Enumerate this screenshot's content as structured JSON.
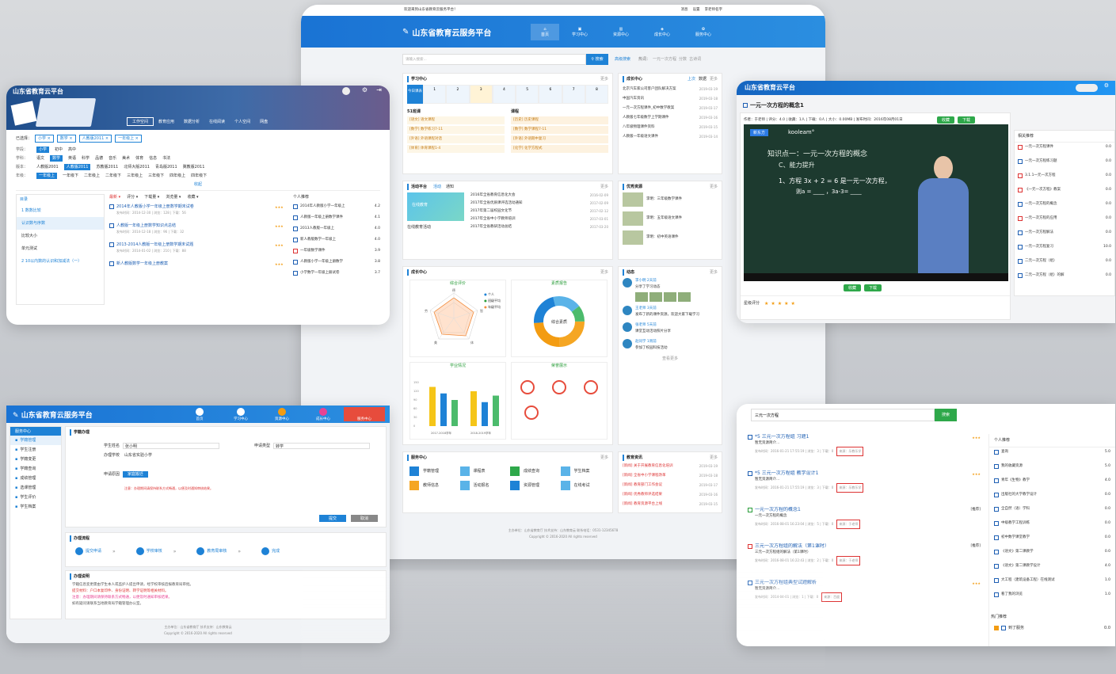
{
  "colors": {
    "brand": "#1e82d6",
    "green": "#2ea84a",
    "red": "#d33"
  },
  "main": {
    "welcome": "欢迎来到山东省教育云服务平台！",
    "top_right": [
      "消息",
      "设置",
      "李老师名字"
    ],
    "logo": "山东省教育云服务平台",
    "nav": [
      "首页",
      "学习中心",
      "资源中心",
      "成长中心",
      "服务中心"
    ],
    "search_placeholder": "请输入搜索...",
    "search_btn": "搜索",
    "adv_search": "高级搜索",
    "hot": "热词：",
    "hot_words": [
      "一元一次方程",
      "分数",
      "古诗词"
    ],
    "study": {
      "title": "学习中心",
      "more": "更多",
      "days": [
        "1",
        "2",
        "3",
        "4",
        "5",
        "6",
        "7",
        "8"
      ],
      "today": "今日课表",
      "left_head": "51班课",
      "right_head": "课程",
      "left": [
        "[语文] 语文课程",
        "[数学] 数学练习7-11",
        "[外语] 外语课程对话",
        "[体育] 体育课程1-4"
      ],
      "right": [
        "[历史] 历史课程",
        "[数学] 数学课程7-11",
        "[外语] 外语期中复习",
        "[化学] 化学方程式"
      ]
    },
    "growth": {
      "title": "成长中心",
      "more": "更多",
      "tabs": [
        "上次",
        "数据",
        "详情"
      ],
      "items": [
        "北京汽车家公司客户团队解决方案",
        "中国汽车资讯",
        "一元一次方程课件_初中数学教案",
        "人教版七年级数学上学期课件",
        "八年级物理课件资料",
        "人教版一年级语文课件"
      ],
      "dates": [
        "2019-03-19",
        "2019-03-18",
        "2019-03-17",
        "2019-03-16",
        "2019-03-15",
        "2019-03-14"
      ]
    },
    "activity": {
      "title": "活动平台",
      "tabs": [
        "活动",
        "通知"
      ],
      "more": "更多",
      "banner": "在线教育",
      "card_title": "在线教育活动",
      "items": [
        "2016年全省教育信息化大会",
        "2017年全省优质课评选活动通知",
        "2017年第二届校园文化节",
        "2017年全省中小学教师培训",
        "2017年全省教研活动总结"
      ],
      "dates": [
        "2016-02-09",
        "2017-02-09",
        "2017-02-12",
        "2017-03-01",
        "2017-03-20"
      ]
    },
    "excellent": {
      "title": "优秀资源",
      "more": "更多",
      "items": [
        "李明：三年级数学课件",
        "李明：五年级语文课件",
        "李明：初中英语课件"
      ]
    },
    "growth2": {
      "title": "成长中心",
      "more": "更多",
      "chart1": "综合评价",
      "chart2": "素质报告",
      "chart3": "学业情况",
      "chart4": "荣誉展示",
      "radar_labels": [
        "德",
        "智",
        "体",
        "美",
        "劳"
      ],
      "legend": [
        "个人",
        "班级平均",
        "年级平均"
      ],
      "bar_years": [
        "2017-2018学年",
        "2018-2019学年"
      ],
      "bars": [
        90,
        75,
        60,
        80,
        55,
        70
      ],
      "donut_center": "综合素质",
      "ticks": [
        "0",
        "30",
        "60",
        "90",
        "120",
        "150"
      ]
    },
    "dynamic": {
      "title": "动态",
      "more": "更多",
      "users": [
        "李小明",
        "王老师",
        "张老师",
        "赵同学"
      ],
      "times": [
        "2天前",
        "3天前",
        "5天前",
        "1周前"
      ],
      "texts": [
        "分享了学习动态",
        "发布了新的课件资源，欢迎大家下载学习",
        "课堂互动活动照片分享",
        "参加了校园科技活动"
      ],
      "more_btn": "查看更多"
    },
    "service": {
      "title": "服务中心",
      "more": "更多",
      "items": [
        "学籍管理",
        "课程表",
        "成绩查询",
        "学生档案",
        "教师信息",
        "活动报名",
        "资源管理",
        "在线考试"
      ]
    },
    "notice": {
      "title": "教育资讯",
      "more": "更多",
      "items": [
        "[新闻] 关于开展教育信息化培训",
        "[新闻] 全省中小学课程改革",
        "[新闻] 教育部门工作会议",
        "[新闻] 优秀教师评选结果",
        "[新闻] 教育资源平台上线"
      ],
      "dates": [
        "2019-03-19",
        "2019-03-18",
        "2019-03-17",
        "2019-03-16",
        "2019-03-15"
      ]
    },
    "footer1": "主办单位：山东省教育厅  技术支持：山东教育云  联系电话：0531-12345678",
    "footer2": "Copyright © 2016-2020 All rights reserved"
  },
  "resource": {
    "logo": "山东省教育云平台",
    "tabs": [
      "工作空间",
      "教育应用",
      "数据分析",
      "在线阅读",
      "个人空间",
      "网盘"
    ],
    "selected_label": "已选择：",
    "selected": [
      "小学",
      "数学",
      "人教版2011",
      "一年级上"
    ],
    "filters": [
      {
        "label": "学段：",
        "items": [
          "小学",
          "初中",
          "高中"
        ]
      },
      {
        "label": "学科：",
        "items": [
          "语文",
          "数学",
          "英语",
          "科学",
          "品德",
          "音乐",
          "美术",
          "体育",
          "信息",
          "书法"
        ]
      },
      {
        "label": "版本：",
        "items": [
          "人教版2001",
          "人教版2011",
          "苏教版2011",
          "北师大版2011",
          "青岛版2011",
          "冀教版2011"
        ]
      },
      {
        "label": "年级：",
        "items": [
          "一年级上",
          "一年级下",
          "二年级上",
          "二年级下",
          "三年级上",
          "三年级下",
          "四年级上",
          "四年级下"
        ]
      }
    ],
    "collapse": "收起",
    "toc_title": "目录",
    "toc": [
      "1 数数比较",
      "认识数与序数",
      "比较大小",
      "单元测试",
      "2 10以内数的认识和加减法（一）"
    ],
    "sort": [
      "最新",
      "评分",
      "下载量",
      "浏览量",
      "收藏"
    ],
    "list": [
      {
        "title": "2014年人教版小学一年级上册数学期末试卷",
        "meta": "发布时间：2014-12-30 | 浏览：128 | 下载：56"
      },
      {
        "title": "人教版一年级上册数学知识点总结",
        "meta": "发布时间：2014-12-18 | 浏览：96 | 下载：32"
      },
      {
        "title": "2013-2014人教版一年级上册数学期末试题",
        "meta": "发布时间：2014-01-02 | 浏览：210 | 下载：88"
      },
      {
        "title": "新人教版数学一年级上册教案"
      }
    ],
    "personal_title": "个人推荐",
    "personal": [
      "2014年人教版小学一年级上",
      "人教版一年级上册数学课件",
      "2013人教版一年级上",
      "新人教版数学一年级上",
      "一年级数学课件",
      "人教版小学一年级上册数学",
      "小学数学一年级上册试卷"
    ],
    "personal_scores": [
      "4.2",
      "4.1",
      "4.0",
      "4.0",
      "3.9",
      "3.8",
      "3.7"
    ]
  },
  "video": {
    "logo": "山东省教育云平台",
    "title": "一元一次方程的概念1",
    "meta": "作者：于老师 | 评分：4.0 | 收藏：1人 | 下载：0人 | 大小：0.00MB | 发布时间：2016年08月01日",
    "collect": "收藏",
    "download": "下载",
    "board_brand": "新东方",
    "board_title": "知识点一：一元一次方程的概念",
    "board_sub": "C、能力提升",
    "board_q": "1、方程 3x + 2 = 6 是一元一次方程，",
    "board_q2": "则a = ____ ，3a-3= ____",
    "rating_label": "星级评分",
    "related_title": "相关推荐",
    "related": [
      "一元一次方程课件",
      "一元一次方程练习题",
      "3.1.1一元一次方程",
      "《一元一次方程》教案",
      "一元一次方程的概念",
      "一元一次方程的应用",
      "一元一次方程解法",
      "一元一次方程复习",
      "二元一次方程（组）",
      "二元一次方程（组）的解"
    ],
    "related_scores": [
      "0.0",
      "0.0",
      "0.0",
      "0.0",
      "0.0",
      "0.0",
      "0.0",
      "10.0",
      "0.0",
      "0.0"
    ]
  },
  "service": {
    "logo": "山东省教育云服务平台",
    "nav": [
      "首页",
      "学习中心",
      "资源中心",
      "成长中心",
      "服务中心"
    ],
    "side_title": "服务中心",
    "side": [
      "学籍管理",
      "学生注册",
      "学籍变更",
      "学籍查询",
      "成绩管理",
      "选课管理",
      "学生评价",
      "学生档案"
    ],
    "form_title": "学籍办理",
    "form_labels": [
      "学生姓名",
      "申请类型",
      "办理学校",
      "申请原因"
    ],
    "form_values": [
      "张小明",
      "转学",
      "山东省实验小学",
      "家庭搬迁"
    ],
    "submit": "提交",
    "save": "保存",
    "cancel": "取消",
    "flow_title": "办理流程",
    "flow": [
      "提交申请",
      "学校审核",
      "教育局审核",
      "完成"
    ],
    "note_title": "办理说明",
    "notes": [
      "学籍信息变更需由学生本人或监护人提出申请，经学校审核后报教育局审批。",
      "提交材料：户口本复印件、身份证明、转学证明等相关材料。",
      "注意：办理期间请保持联系方式畅通，以便及时通知审核结果。",
      "如有疑问请联系当地教育局学籍管理办公室。"
    ],
    "footer1": "主办单位：山东省教育厅  技术支持：山东教育云",
    "footer2": "Copyright © 2016-2020 All rights reserved"
  },
  "search": {
    "query": "三元一次方程",
    "btn": "搜索",
    "results": [
      {
        "title": "*5 三元一次方程组 习题1",
        "sub": "暂无资源简介...",
        "meta": "发布时间：2016-01-21 17:55:19 | 浏览：3 | 下载：0",
        "src": "来源：乐教乐学"
      },
      {
        "title": "*5 三元一次方程组 教学设计1",
        "sub": "暂无资源简介...",
        "meta": "发布时间：2016-01-21 17:55:19 | 浏览：3 | 下载：0",
        "src": "来源：乐教乐学"
      },
      {
        "title": "一元一次方程的概念1",
        "sub": "一元一次方程的概念",
        "meta": "发布时间：2016-08-01 16:23:04 | 浏览：5 | 下载：0",
        "src": "来源：于老师"
      },
      {
        "title": "三元一次方程组的解法（第1课时）",
        "sub": "三元一次方程组的解法（第1课时）",
        "meta": "发布时间：2016-08-01 16:22:43 | 浏览：2 | 下载：0",
        "src": "来源：于老师"
      },
      {
        "title": "三元一次方程组典型试题解析",
        "sub": "暂无资源简介...",
        "meta": "发布时间：2014-04-01 | 浏览：1 | 下载：0",
        "src": "来源：百度"
      }
    ],
    "tags": [
      "[推荐]",
      "[推荐]",
      "[推荐]"
    ],
    "personal_title": "个人推荐",
    "personal": [
      "查询",
      "我的收藏资源",
      "青年《生物》教学",
      "出版社的大学教学设计",
      "全自然（语）学科",
      "中级教学工程训练",
      "初中数学课堂教学",
      "《语文》第二课教学",
      "《语文》第二课教学设计",
      "大工程（建筑设备工程）在线测试",
      "看了我的浏览"
    ],
    "personal_scores": [
      "5.0",
      "5.0",
      "4.0",
      "0.0",
      "0.0",
      "0.0",
      "0.0",
      "0.0",
      "4.0",
      "1.0",
      "1.0"
    ],
    "hot_title": "热门推荐",
    "hot": [
      "到了服务"
    ],
    "hot_scores": [
      "0.0"
    ]
  }
}
